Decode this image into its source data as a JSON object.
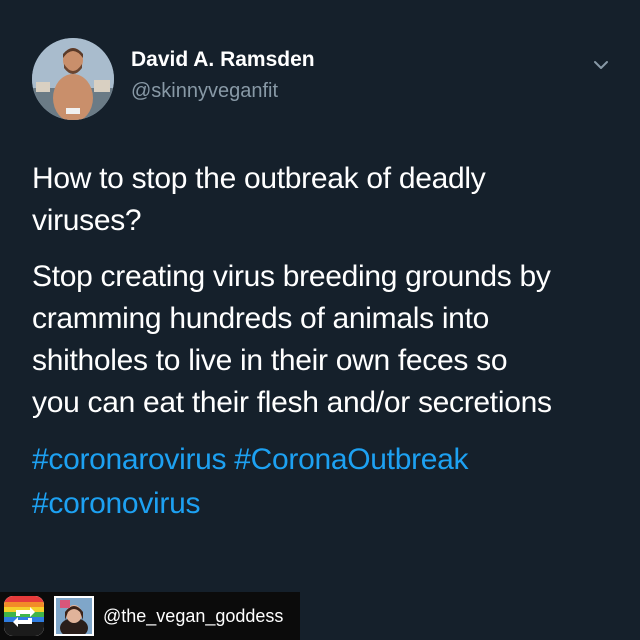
{
  "author": {
    "name": "David A. Ramsden",
    "handle": "@skinnyveganfit"
  },
  "tweet": {
    "paragraph1": [
      "How to stop the outbreak of deadly",
      "viruses?"
    ],
    "paragraph2": [
      "Stop creating virus breeding grounds by",
      "cramming hundreds of animals into",
      "shitholes to live in their own feces so",
      "you can eat their flesh and/or secretions"
    ],
    "hashtags": [
      "#coronarovirus #CoronaOutbreak",
      "#coronovirus"
    ]
  },
  "regram": {
    "username": "@the_vegan_goddess"
  },
  "icons": {
    "menu": "chevron-down-icon",
    "repost": "regram-app-icon"
  },
  "colors": {
    "background": "#15202b",
    "hashtag": "#1da1f2",
    "secondary_text": "#8899a6"
  }
}
